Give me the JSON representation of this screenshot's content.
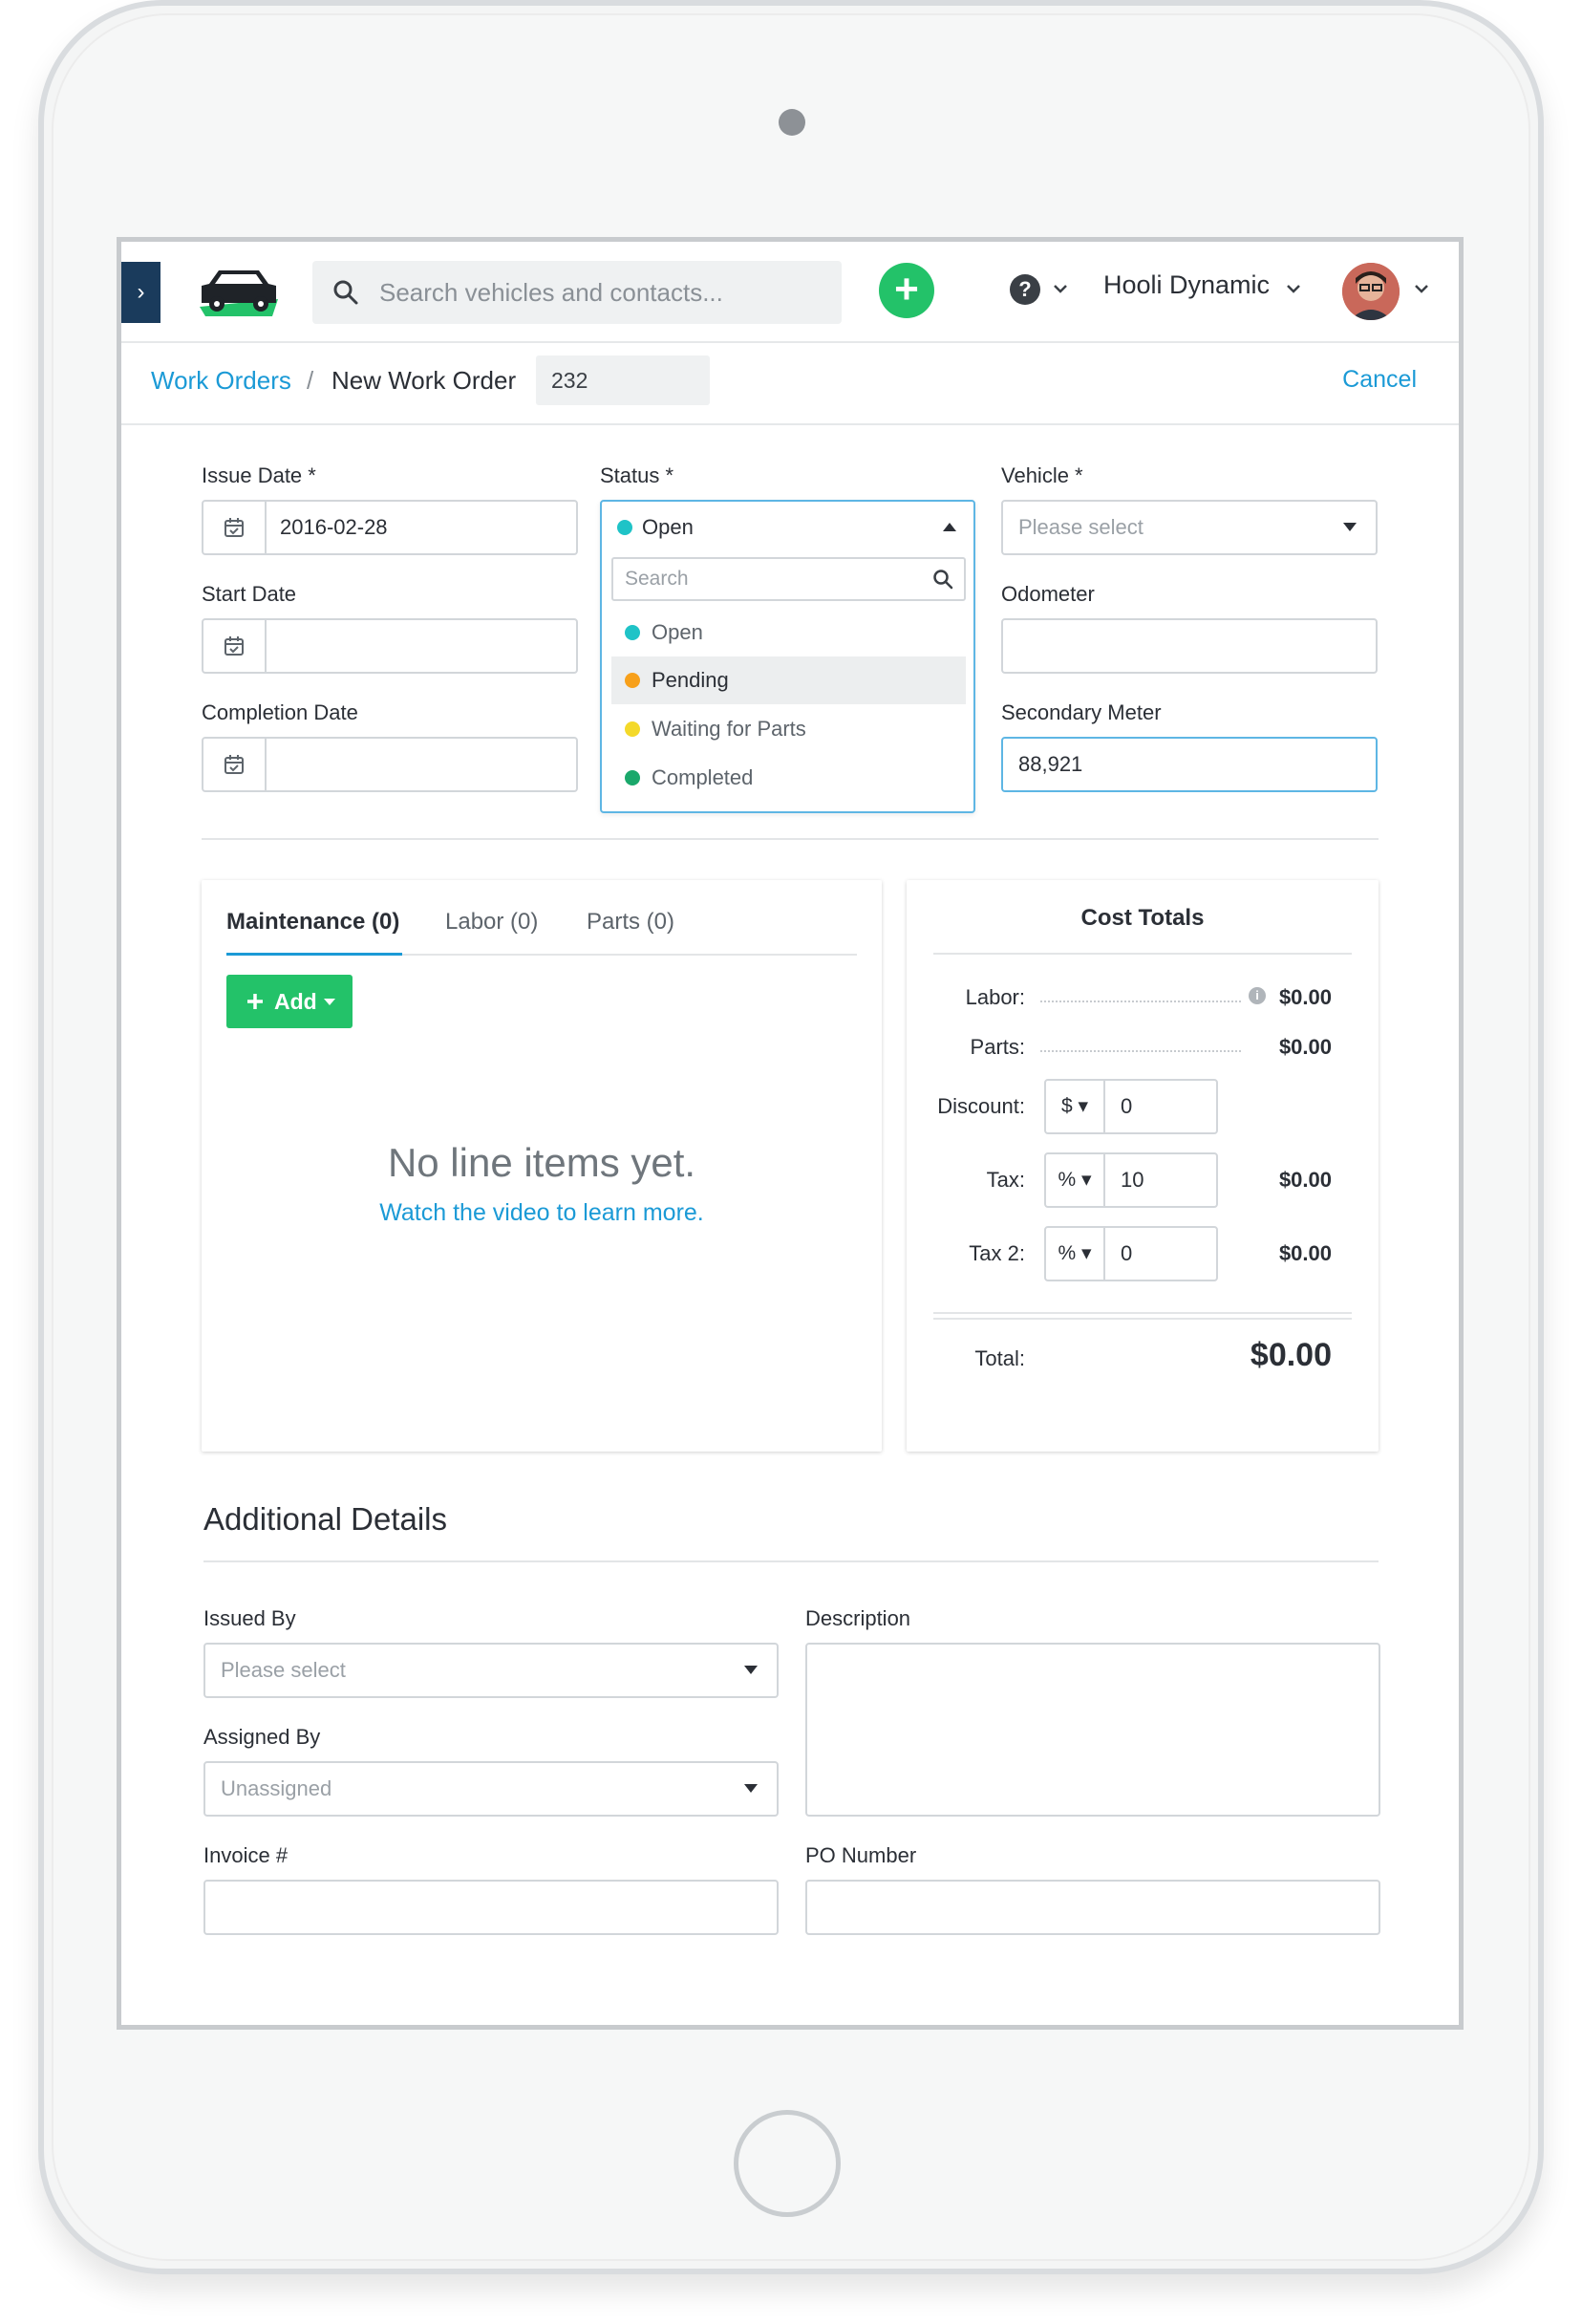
{
  "nav": {
    "search_placeholder": "Search vehicles and contacts...",
    "org_name": "Hooli Dynamic",
    "toggle_glyph": "›",
    "add_glyph": "+",
    "help_glyph": "?"
  },
  "breadcrumb": {
    "parent": "Work Orders",
    "separator": "/",
    "current": "New Work Order",
    "number": "232",
    "cancel_label": "Cancel"
  },
  "form": {
    "issue_date": {
      "label": "Issue Date *",
      "value": "2016-02-28"
    },
    "start_date": {
      "label": "Start Date",
      "value": ""
    },
    "completion_date": {
      "label": "Completion Date",
      "value": ""
    },
    "status": {
      "label": "Status *",
      "selected": "Open",
      "search_placeholder": "Search",
      "options": [
        {
          "label": "Open",
          "color": "#1fc3c7"
        },
        {
          "label": "Pending",
          "color": "#f7a01b"
        },
        {
          "label": "Waiting for Parts",
          "color": "#f4d92a"
        },
        {
          "label": "Completed",
          "color": "#1aa86b"
        }
      ],
      "highlighted": "Pending"
    },
    "vehicle": {
      "label": "Vehicle *",
      "placeholder": "Please select"
    },
    "odometer": {
      "label": "Odometer",
      "value": ""
    },
    "secondary_meter": {
      "label": "Secondary Meter",
      "value": "88,921"
    }
  },
  "line_items": {
    "tabs": [
      "Maintenance (0)",
      "Labor (0)",
      "Parts (0)"
    ],
    "active_tab": "Maintenance (0)",
    "add_label": "Add",
    "empty_title": "No line items yet.",
    "empty_link": "Watch the video to learn more."
  },
  "cost_totals": {
    "title": "Cost Totals",
    "labor": {
      "label": "Labor:",
      "value": "$0.00"
    },
    "parts": {
      "label": "Parts:",
      "value": "$0.00"
    },
    "discount": {
      "label": "Discount:",
      "unit": "$",
      "amount": "0"
    },
    "tax": {
      "label": "Tax:",
      "unit": "%",
      "amount": "10",
      "value": "$0.00"
    },
    "tax2": {
      "label": "Tax 2:",
      "unit": "%",
      "amount": "0",
      "value": "$0.00"
    },
    "total": {
      "label": "Total:",
      "value": "$0.00"
    }
  },
  "additional": {
    "title": "Additional Details",
    "issued_by": {
      "label": "Issued By",
      "placeholder": "Please select"
    },
    "assigned_by": {
      "label": "Assigned By",
      "placeholder": "Unassigned"
    },
    "invoice": {
      "label": "Invoice #",
      "value": ""
    },
    "description": {
      "label": "Description",
      "value": ""
    },
    "po_number": {
      "label": "PO Number",
      "value": ""
    }
  },
  "colors": {
    "accent_blue": "#1b9ad6",
    "brand_green": "#23c269",
    "nav_dark": "#1a3b5c"
  }
}
